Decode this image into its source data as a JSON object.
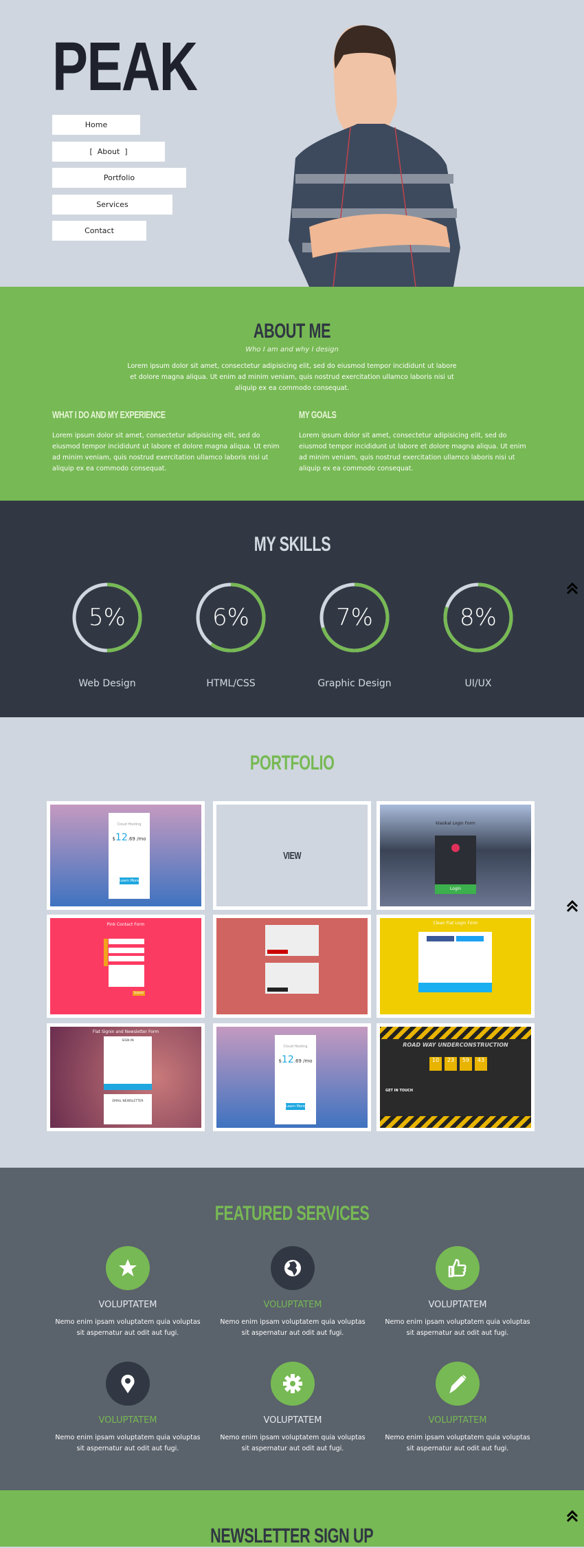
{
  "header": {
    "logo": "PEAK",
    "nav": [
      {
        "label": "Home"
      },
      {
        "label": "[  About  ]"
      },
      {
        "label": "Portfolio"
      },
      {
        "label": "Services"
      },
      {
        "label": "Contact"
      }
    ]
  },
  "about": {
    "title": "ABOUT ME",
    "subtitle": "Who I am and why I design",
    "intro": "Lorem ipsum dolor sit amet, consectetur adipisicing elit, sed do eiusmod tempor incididunt ut labore et dolore magna aliqua. Ut enim ad minim veniam, quis nostrud exercitation ullamco laboris nisi ut aliquip ex ea commodo consequat.",
    "columns": [
      {
        "heading": "WHAT I DO AND MY EXPERIENCE",
        "text": "Lorem ipsum dolor sit amet, consectetur adipisicing elit, sed do eiusmod tempor incididunt ut labore et dolore magna aliqua. Ut enim ad minim veniam, quis nostrud exercitation ullamco laboris nisi ut aliquip ex ea commodo consequat."
      },
      {
        "heading": "MY GOALS",
        "text": "Lorem ipsum dolor sit amet, consectetur adipisicing elit, sed do eiusmod tempor incididunt ut labore et dolore magna aliqua. Ut enim ad minim veniam, quis nostrud exercitation ullamco laboris nisi ut aliquip ex ea commodo consequat."
      }
    ]
  },
  "skills": {
    "title": "MY SKILLS",
    "items": [
      {
        "value": "5%",
        "label": "Web Design",
        "ring_fill": 0.5
      },
      {
        "value": "6%",
        "label": "HTML/CSS",
        "ring_fill": 0.6
      },
      {
        "value": "7%",
        "label": "Graphic Design",
        "ring_fill": 0.7
      },
      {
        "value": "8%",
        "label": "UI/UX",
        "ring_fill": 0.8
      }
    ]
  },
  "portfolio": {
    "title": "PORTFOLIO",
    "view_label": "VIEW",
    "thumbs": {
      "cloud_title": "Cloud Hosting",
      "price_currency": "$",
      "price_int": "12",
      "price_rest": ".69 /mo",
      "cloud_button": "Learn More",
      "login_title": "klasikal Login Form",
      "login_button": "Login",
      "pink_title": "Pink Contact Form",
      "pink_button": "Submit",
      "clean_title": "Clean Flat Login Form",
      "flat_title": "Flat Signin and Newsletter Form",
      "sign_in": "SIGN IN",
      "email_newsletter": "EMAIL NEWSLETTER",
      "road_title": "ROAD WAY UNDERCONSTRUCTION",
      "get_in_touch": "GET IN TOUCH",
      "countdown": [
        "10",
        "23",
        "59",
        "43"
      ]
    }
  },
  "services": {
    "title": "FEATURED SERVICES",
    "items": [
      {
        "icon": "star-icon",
        "title": "VOLUPTATEM",
        "text": "Nemo enim ipsam voluptatem quia voluptas sit aspernatur aut odit aut fugi.",
        "circle": "#77b954",
        "title_color": "#e6e9ee"
      },
      {
        "icon": "globe-icon",
        "title": "VOLUPTATEM",
        "text": "Nemo enim ipsam voluptatem quia voluptas sit aspernatur aut odit aut fugi.",
        "circle": "#313843",
        "title_color": "#77b954"
      },
      {
        "icon": "thumbs-up-icon",
        "title": "VOLUPTATEM",
        "text": "Nemo enim ipsam voluptatem quia voluptas sit aspernatur aut odit aut fugi.",
        "circle": "#77b954",
        "title_color": "#e6e9ee"
      },
      {
        "icon": "map-pin-icon",
        "title": "VOLUPTATEM",
        "text": "Nemo enim ipsam voluptatem quia voluptas sit aspernatur aut odit aut fugi.",
        "circle": "#313843",
        "title_color": "#77b954"
      },
      {
        "icon": "gear-icon",
        "title": "VOLUPTATEM",
        "text": "Nemo enim ipsam voluptatem quia voluptas sit aspernatur aut odit aut fugi.",
        "circle": "#77b954",
        "title_color": "#e6e9ee"
      },
      {
        "icon": "pencil-icon",
        "title": "VOLUPTATEM",
        "text": "Nemo enim ipsam voluptatem quia voluptas sit aspernatur aut odit aut fugi.",
        "circle": "#77b954",
        "title_color": "#77b954"
      }
    ]
  },
  "newsletter": {
    "title": "NEWSLETTER SIGN UP"
  },
  "colors": {
    "green": "#77b954",
    "dark": "#313843",
    "slate": "#5a626b",
    "light": "#cfd6df"
  }
}
